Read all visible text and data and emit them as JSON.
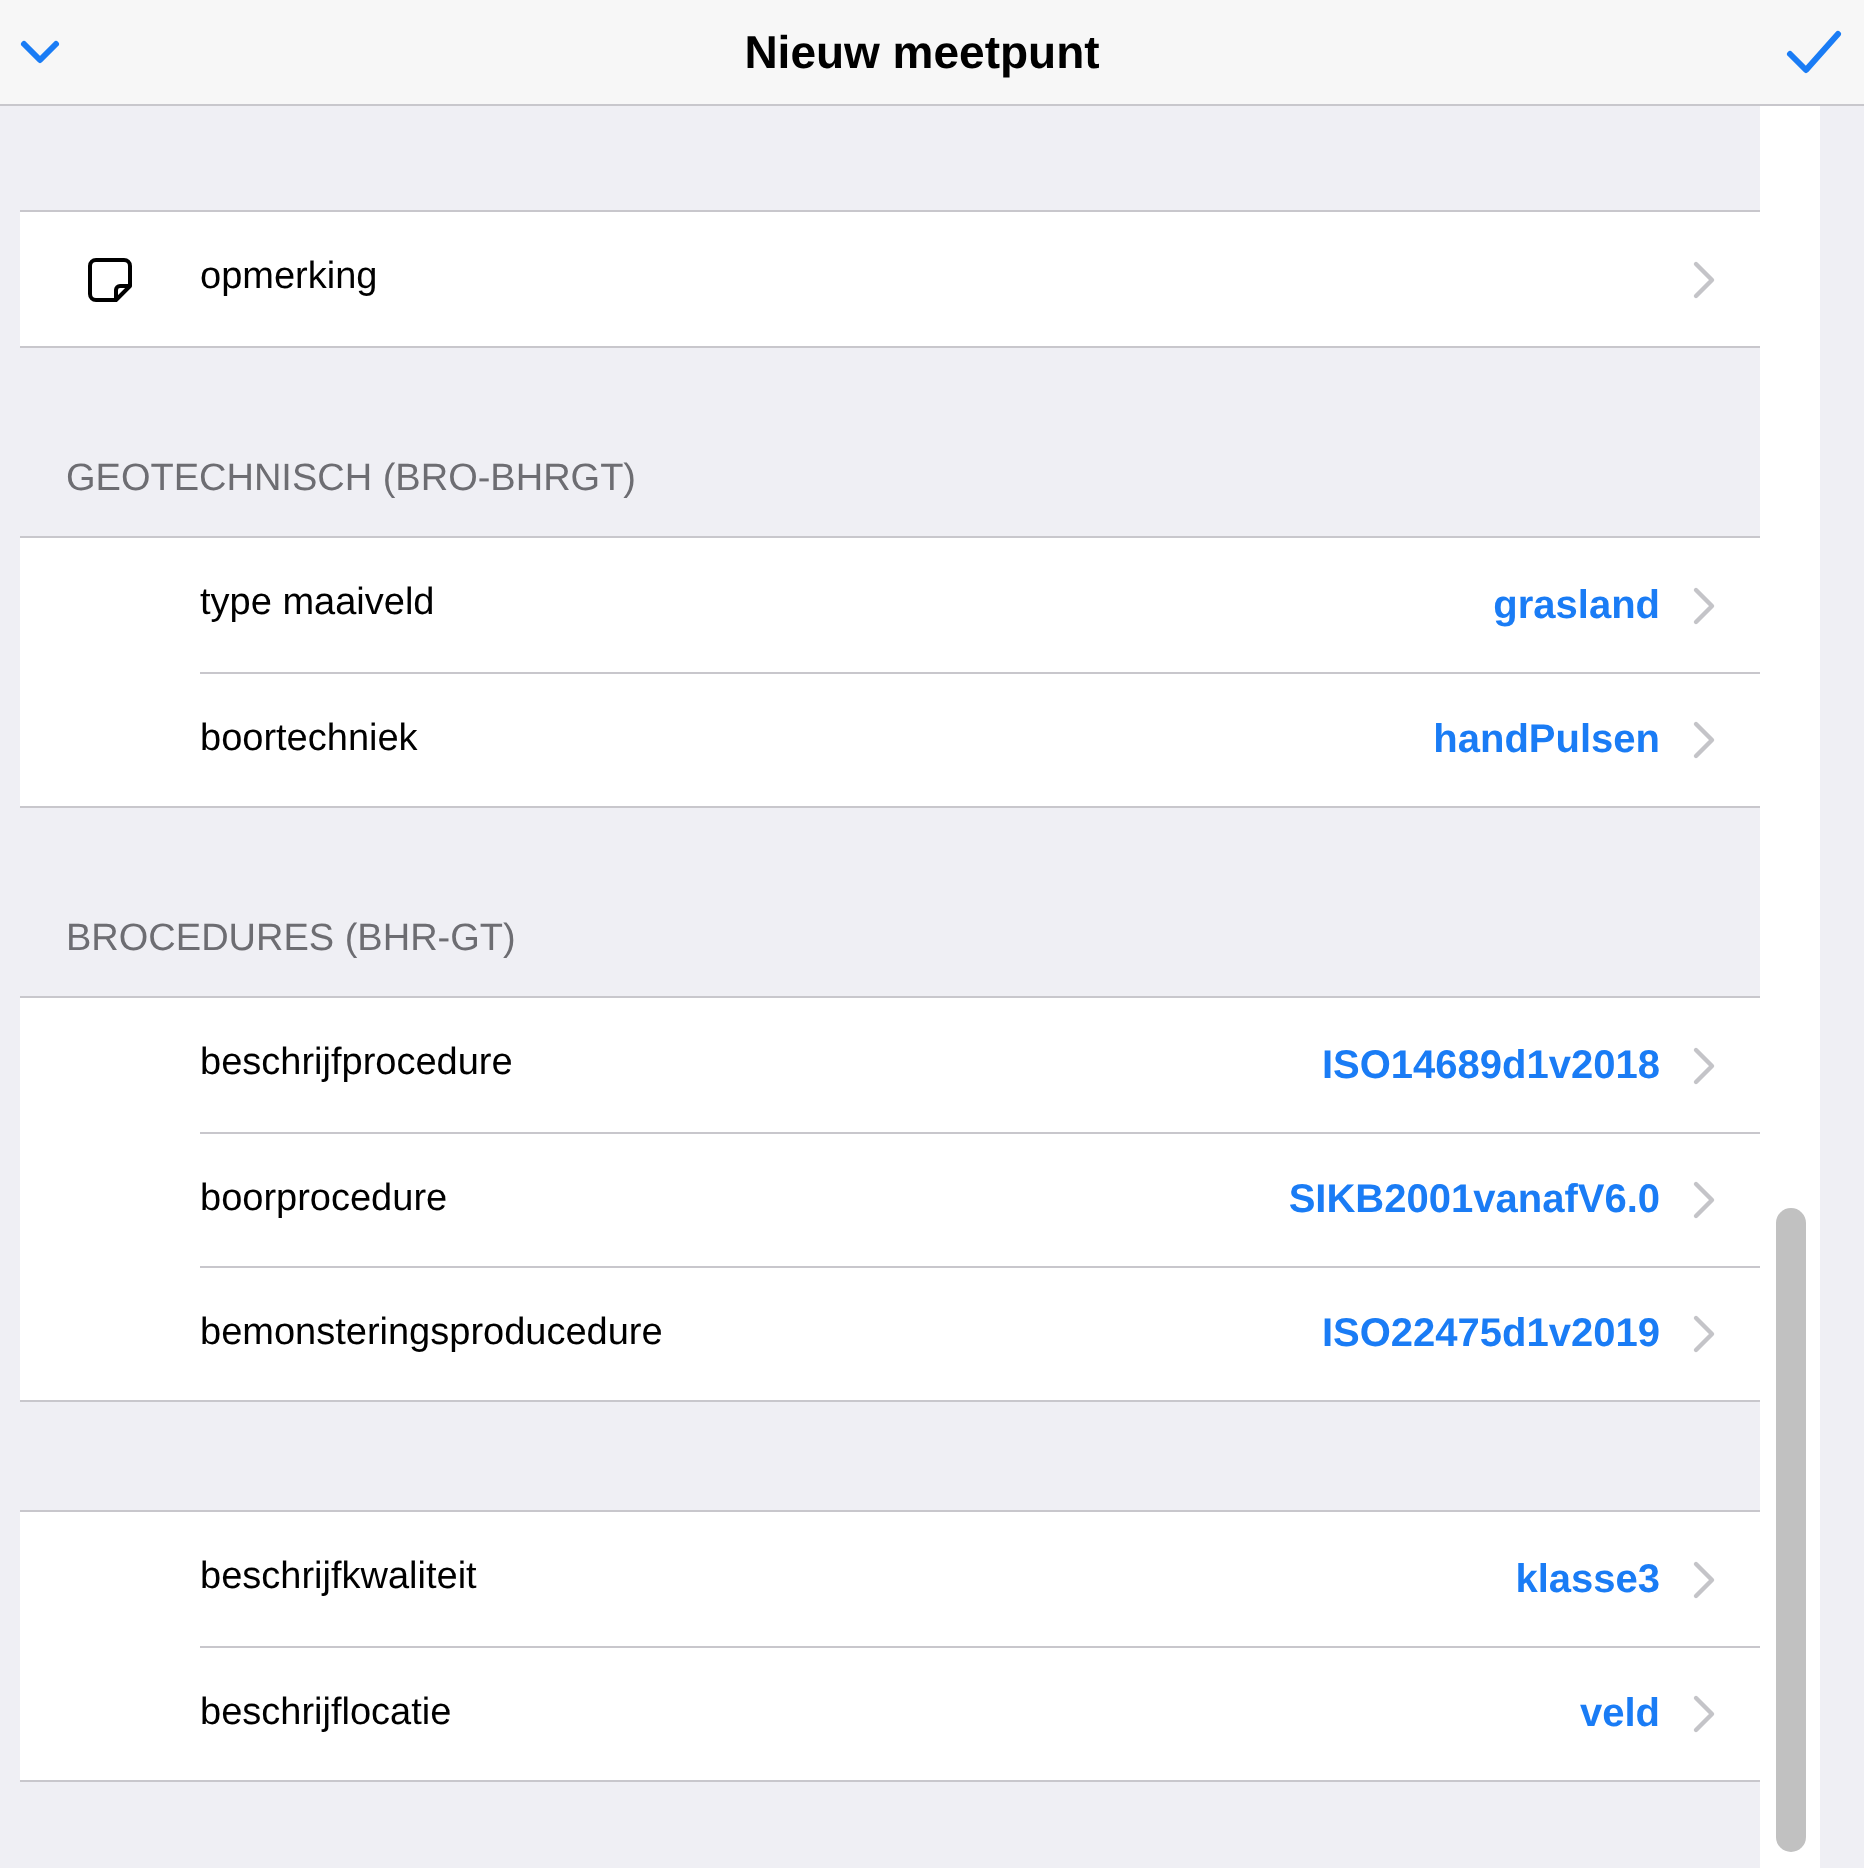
{
  "header": {
    "title": "Nieuw meetpunt"
  },
  "sections": [
    {
      "items": [
        {
          "label": "opmerking",
          "kind": "note"
        }
      ]
    },
    {
      "title": "GEOTECHNISCH (BRO-BHRGT)",
      "items": [
        {
          "label": "type maaiveld",
          "value": "grasland"
        },
        {
          "label": "boortechniek",
          "value": "handPulsen"
        }
      ]
    },
    {
      "title": "BROCEDURES (BHR-GT)",
      "items": [
        {
          "label": "beschrijfprocedure",
          "value": "ISO14689d1v2018"
        },
        {
          "label": "boorprocedure",
          "value": "SIKB2001vanafV6.0"
        },
        {
          "label": "bemonsteringsproducedure",
          "value": "ISO22475d1v2019"
        }
      ]
    },
    {
      "items": [
        {
          "label": "beschrijfkwaliteit",
          "value": "klasse3"
        },
        {
          "label": "beschrijflocatie",
          "value": "veld"
        }
      ]
    }
  ]
}
